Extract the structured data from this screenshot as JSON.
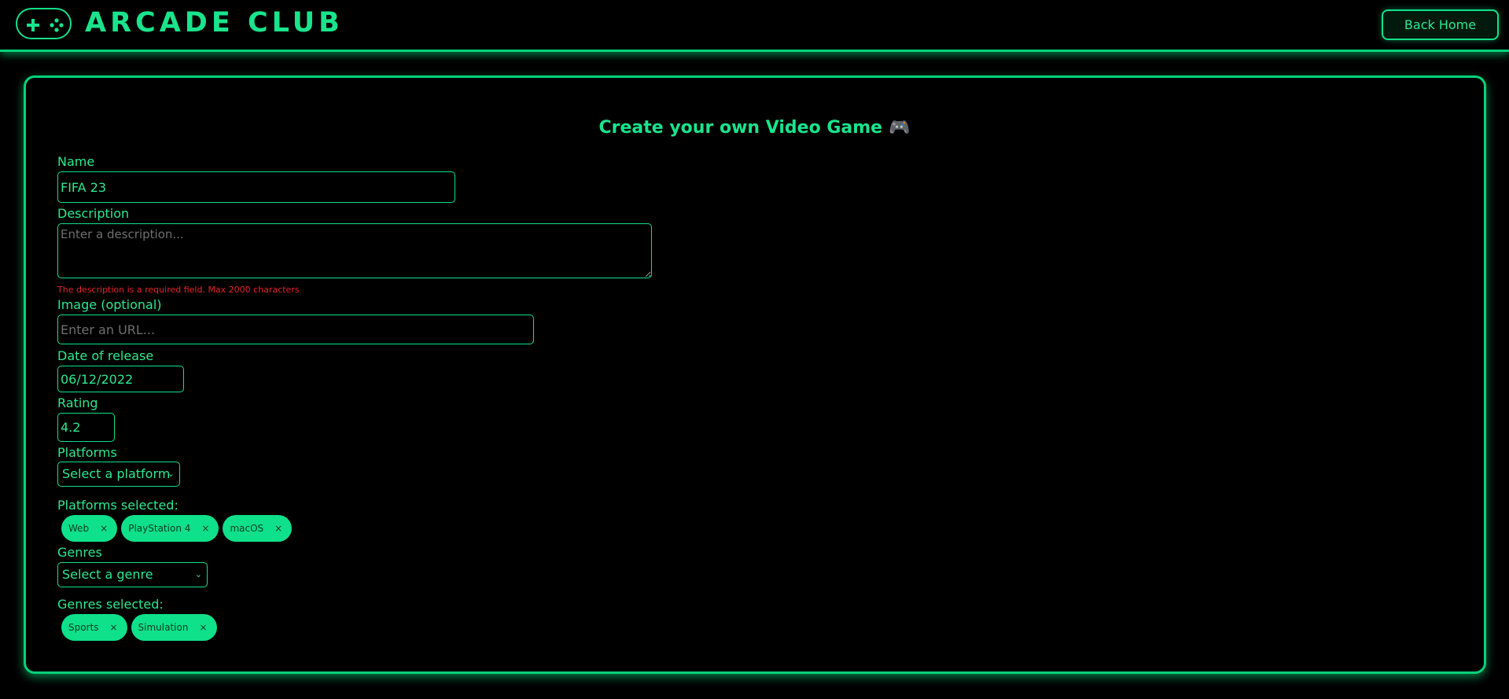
{
  "header": {
    "logo_text": "ARCADE CLUB",
    "back_button": "Back Home"
  },
  "form": {
    "title": "Create your own Video Game",
    "title_icon": "gamepad-icon",
    "name": {
      "label": "Name",
      "value": "FIFA 23"
    },
    "description": {
      "label": "Description",
      "value": "",
      "placeholder": "Enter a description...",
      "error": "The description is a required field. Max 2000 characters"
    },
    "image": {
      "label": "Image (optional)",
      "value": "",
      "placeholder": "Enter an URL..."
    },
    "release_date": {
      "label": "Date of release",
      "value": "06/12/2022"
    },
    "rating": {
      "label": "Rating",
      "value": "4.2"
    },
    "platforms": {
      "label": "Platforms",
      "select_value": "Select a platform",
      "selected_label": "Platforms selected:",
      "selected": [
        {
          "name": "Web",
          "remove": "×"
        },
        {
          "name": "PlayStation 4",
          "remove": "×"
        },
        {
          "name": "macOS",
          "remove": "×"
        }
      ]
    },
    "genres": {
      "label": "Genres",
      "select_value": "Select a genre",
      "selected_label": "Genres selected:",
      "selected": [
        {
          "name": "Sports",
          "remove": "×"
        },
        {
          "name": "Simulation",
          "remove": "×"
        }
      ]
    }
  },
  "colors": {
    "accent": "#12e08a",
    "background": "#000000",
    "error": "#e6242b",
    "chip_bg": "#0fe08a"
  }
}
